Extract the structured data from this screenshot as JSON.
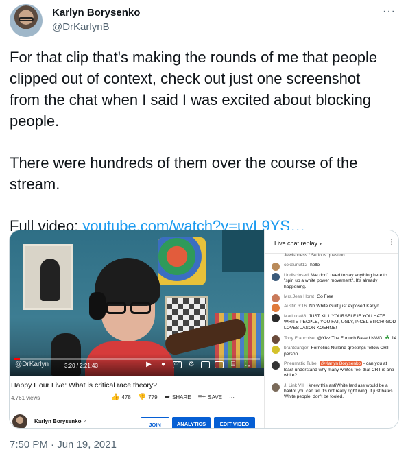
{
  "tweet": {
    "author_name": "Karlyn Borysenko",
    "author_handle": "@DrKarlynB",
    "more_glyph": "···",
    "text_line1": "For that clip that's making the rounds of me that people clipped out of context, check out just one screenshot from the chat when I said I was excited about blocking people.",
    "text_line2": "There were hundreds of them over the course of the stream.",
    "full_video_label": "Full video:",
    "link_text": "youtube.com/watch?v=uvL9YS…",
    "timestamp": "7:50 PM · Jun 19, 2021"
  },
  "video": {
    "watermark": "@DrKarlyn",
    "time": "3:20 / 2:21:43",
    "progress_fraction": 0.024,
    "title": "Happy Hour Live: What is critical race theory?",
    "views": "4,761 views",
    "likes": "478",
    "dislikes": "779",
    "share_label": "SHARE",
    "save_label": "SAVE",
    "more_label": "···",
    "channel_name": "Karlyn Borysenko",
    "join_label": "JOIN",
    "analytics_label": "ANALYTICS",
    "edit_label": "EDIT VIDEO",
    "controls": {
      "cc": "CC",
      "hd": "HD"
    }
  },
  "chat": {
    "title": "Live chat replay",
    "caret": "▾",
    "menu": "⋮",
    "cut_message": "Jewishness / Serious question.",
    "messages": [
      {
        "author": "cokeunut12",
        "text": "hello",
        "color": "#b98a5a"
      },
      {
        "author": "Undisclosed",
        "text": "We don't need to say anything here to \"spin up a white power movement\". It's already happening.",
        "color": "#3b5a7a"
      },
      {
        "author": "Mrs.Jess Horst",
        "text": "Go Free",
        "color": "#c97a5a"
      },
      {
        "author": "Austin 3:16",
        "text": "No White Guilt just exposed Karlyn.",
        "color": "#e07a3a"
      },
      {
        "author": "Marluxia88",
        "text": "JUST KILL YOURSELF IF YOU HATE WHITE PEOPLE, YOU FAT, UGLY, INCEL BITCH! GOD LOVES JASON KOEHNE!",
        "color": "#2b2b2b"
      },
      {
        "author": "Tony Franchise",
        "text": "@Yizz The Eunuch Based NWG!",
        "extra": "14",
        "color": "#6a4b3a"
      },
      {
        "author": "brantdanger",
        "text": "Fornelius Nulland greetings fellow CRT person",
        "color": "#d4c12a"
      },
      {
        "author": "Pneumatic Tube",
        "mention": "@Karlyn Borysenko",
        "text": "can you at least understand why many whites feel that CRT is anti-white?",
        "color": "#333333"
      },
      {
        "author": "J. Link VII",
        "text": "i knew this antiWhite lard ass would be a baldo! you can tell it's not really right wing. it just hates White people. don't be fooled.",
        "color": "#7a6a5a"
      }
    ]
  }
}
